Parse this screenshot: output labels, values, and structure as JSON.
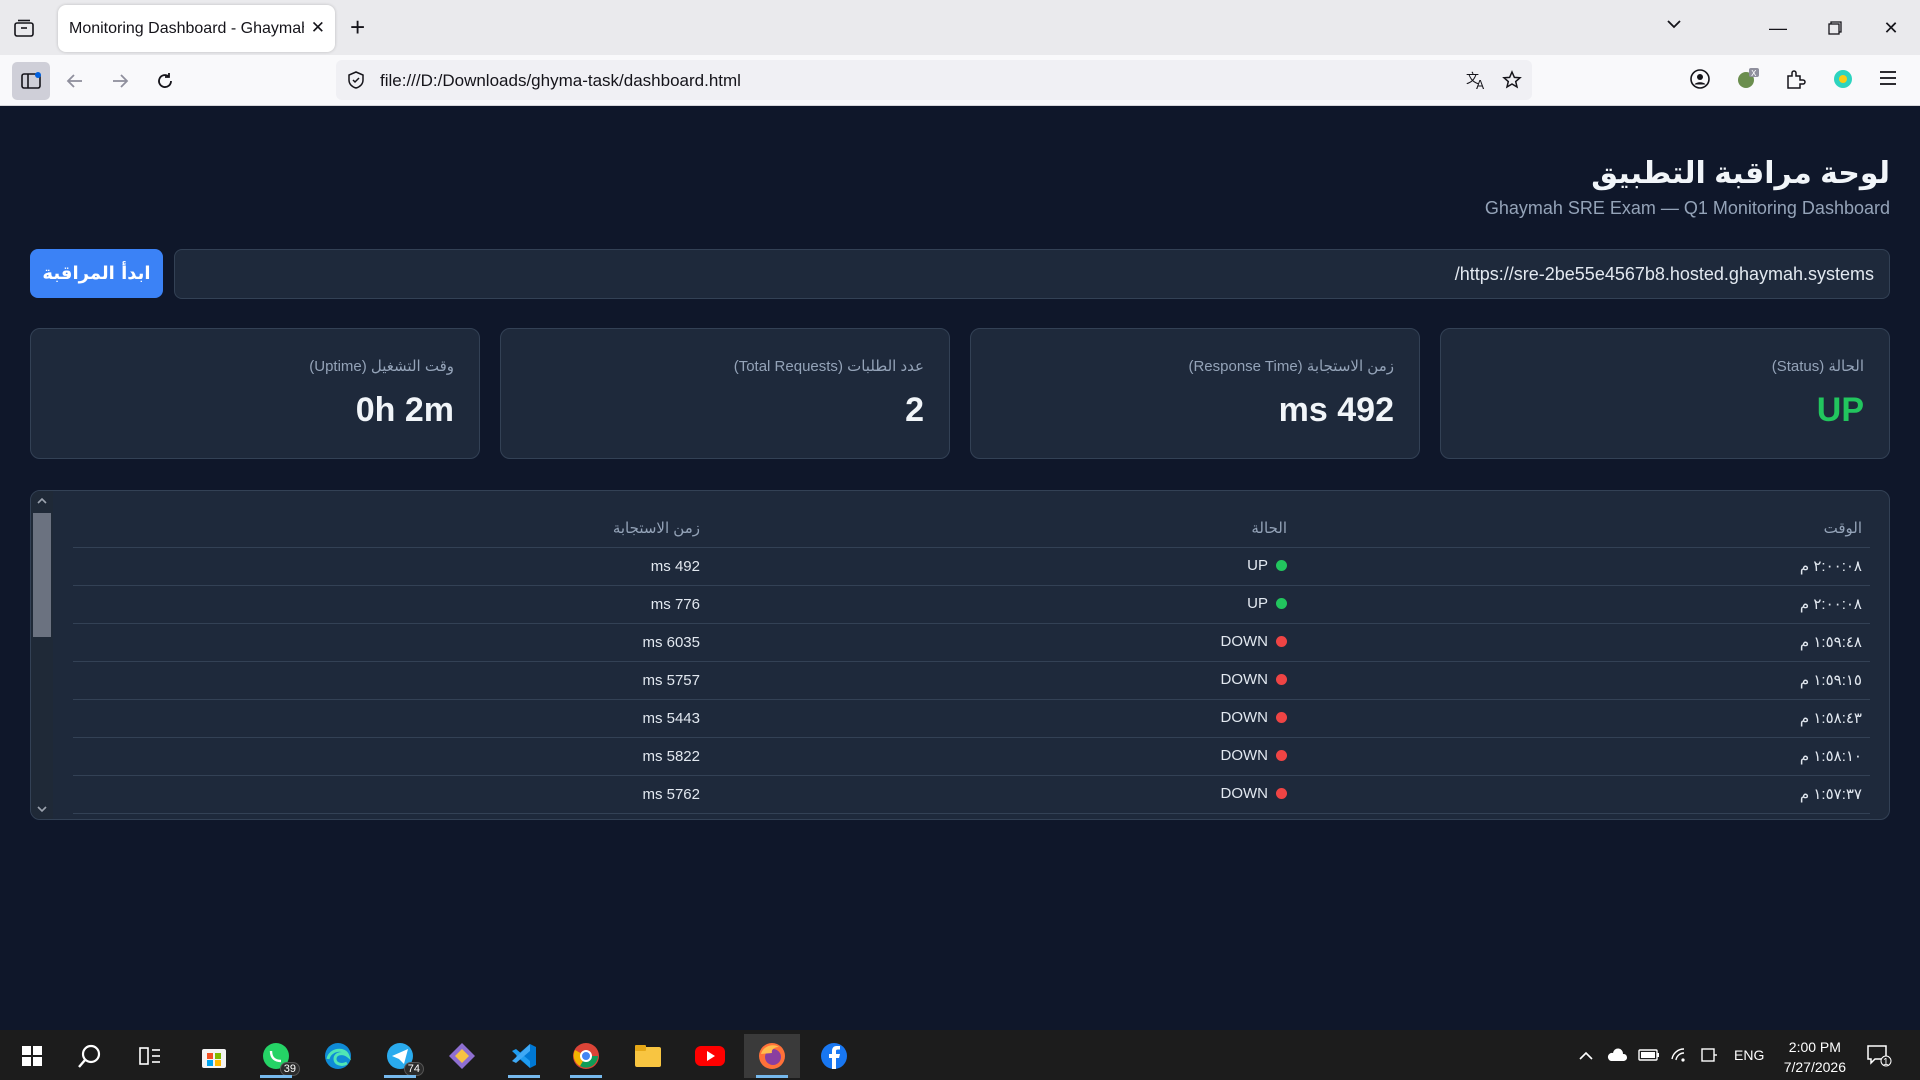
{
  "browser": {
    "tab_title": "Monitoring Dashboard - Ghaymah Exam",
    "url": "file:///D:/Downloads/ghyma-task/dashboard.html"
  },
  "header": {
    "title": "لوحة مراقبة التطبيق",
    "subtitle": "Ghaymah SRE Exam — Q1 Monitoring Dashboard"
  },
  "controls": {
    "target_url": "https://sre-2be55e4567b8.hosted.ghaymah.systems/",
    "start_label": "ابدأ المراقبة"
  },
  "cards": {
    "status": {
      "label": "الحالة (Status)",
      "value": "UP"
    },
    "response_time": {
      "label": "زمن الاستجابة (Response Time)",
      "value": "492 ms"
    },
    "total_requests": {
      "label": "عدد الطلبات (Total Requests)",
      "value": "2"
    },
    "uptime": {
      "label": "وقت التشغيل (Uptime)",
      "value": "0h 2m"
    }
  },
  "log": {
    "headers": {
      "time": "الوقت",
      "status": "الحالة",
      "response": "زمن الاستجابة"
    },
    "rows": [
      {
        "time": "٢:٠٠:٠٨ م",
        "status": "UP",
        "response": "492 ms"
      },
      {
        "time": "٢:٠٠:٠٨ م",
        "status": "UP",
        "response": "776 ms"
      },
      {
        "time": "١:٥٩:٤٨ م",
        "status": "DOWN",
        "response": "6035 ms"
      },
      {
        "time": "١:٥٩:١٥ م",
        "status": "DOWN",
        "response": "5757 ms"
      },
      {
        "time": "١:٥٨:٤٣ م",
        "status": "DOWN",
        "response": "5443 ms"
      },
      {
        "time": "١:٥٨:١٠ م",
        "status": "DOWN",
        "response": "5822 ms"
      },
      {
        "time": "١:٥٧:٣٧ م",
        "status": "DOWN",
        "response": "5762 ms"
      }
    ]
  },
  "taskbar": {
    "whatsapp_badge": "39",
    "telegram_badge": "74",
    "language": "ENG",
    "time": "2:00 PM",
    "date": "7/27/2026",
    "notification_count": "1"
  },
  "colors": {
    "up": "#22c55e",
    "down": "#ef4444",
    "accent": "#3b82f6",
    "page_bg": "#0f172a",
    "card_bg": "#1e293b"
  }
}
